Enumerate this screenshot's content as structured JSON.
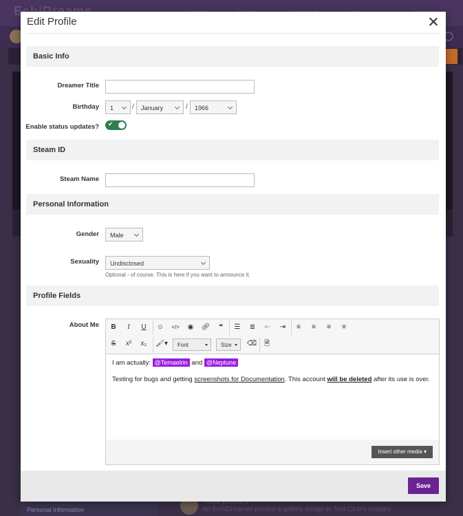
{
  "modal": {
    "title": "Edit Profile",
    "save_label": "Save"
  },
  "sections": {
    "basic_info": "Basic Info",
    "steam_id": "Steam ID",
    "personal_information": "Personal Information",
    "profile_fields": "Profile Fields"
  },
  "basic": {
    "dreamer_title_label": "Dreamer Title",
    "dreamer_title_value": "",
    "birthday_label": "Birthday",
    "birthday_day": "1",
    "birthday_month": "January",
    "birthday_year": "1966",
    "status_updates_label": "Enable status updates?",
    "status_updates_enabled": true
  },
  "steam": {
    "name_label": "Steam Name",
    "name_value": ""
  },
  "personal": {
    "gender_label": "Gender",
    "gender_value": "Male",
    "sexuality_label": "Sexuality",
    "sexuality_value": "Undisclosed",
    "sexuality_hint": "Optional - of course. This is here if you want to announce it."
  },
  "profile_fields": {
    "about_label": "About Me",
    "font_dropdown": "Font",
    "size_dropdown": "Size",
    "about_line1_prefix": "I am actually:",
    "mention1": "@Temaelrin",
    "about_line1_and": "and",
    "mention2": "@Neptune",
    "about_line2_a": "Testing for bugs and getting",
    "about_line2_link": "screenshots for Documentation",
    "about_line2_b": ". This account",
    "about_line2_bold": "will be deleted",
    "about_line2_c": "after its use is over.",
    "insert_media_label": "Insert other media ▾"
  },
  "background": {
    "logo_text": "EchiDreams",
    "nav_items": [
      "Forums",
      "Gallery",
      "Downloads",
      "Clubs",
      "Members"
    ],
    "bottom_panel_label": "Personal Information",
    "post_title": "Test picture",
    "post_line": "An EchiDreamer posted a gallery image in Test Club's Images"
  },
  "colors": {
    "accent_purple": "#6b2392",
    "mention_purple": "#9a1be0",
    "toggle_green": "#2f7d4f"
  }
}
